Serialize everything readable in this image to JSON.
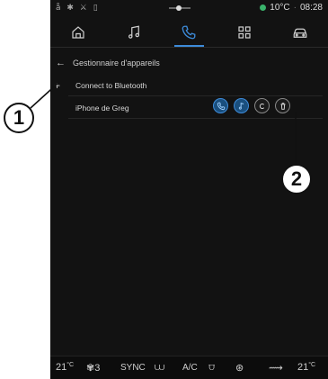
{
  "status_bar": {
    "left_icons": "å ✱ ⚔ ▯",
    "temperature": "10°C",
    "time": "08:28",
    "indicator_color": "#39b36b"
  },
  "nav": {
    "items": [
      {
        "icon": "home-icon"
      },
      {
        "icon": "music-icon"
      },
      {
        "icon": "phone-icon",
        "active": true
      },
      {
        "icon": "apps-icon"
      },
      {
        "icon": "car-icon"
      }
    ],
    "accent": "#3d8bd9"
  },
  "header": {
    "back_symbol": "←",
    "title": "Gestionnaire d'appareils"
  },
  "connect": {
    "plus": "+",
    "label": "Connect to Bluetooth"
  },
  "device": {
    "name": "iPhone de Greg",
    "actions": [
      "phone-icon",
      "music-note-icon",
      "carplay-icon",
      "trash-icon"
    ]
  },
  "bottom_bar": {
    "left_temp": "21",
    "left_unit": "°C",
    "fan_level": "3",
    "sync": "SYNC",
    "ac": "A/C",
    "right_temp": "21",
    "right_unit": "°C"
  },
  "callouts": {
    "one": "1",
    "two": "2"
  }
}
